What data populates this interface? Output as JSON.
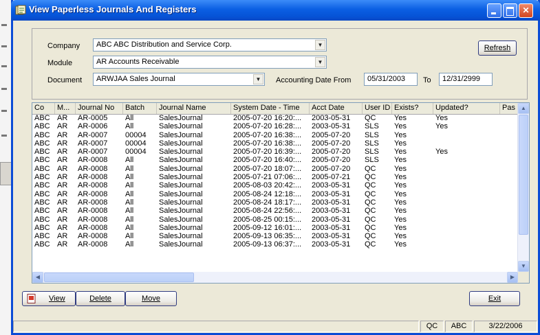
{
  "window": {
    "title": "View Paperless Journals And Registers"
  },
  "filters": {
    "company_label": "Company",
    "company_value": "ABC  ABC Distribution and Service Corp.",
    "module_label": "Module",
    "module_value": "AR  Accounts Receivable",
    "document_label": "Document",
    "document_value": "ARWJAA  Sales Journal",
    "date_from_label": "Accounting Date From",
    "date_from_value": "05/31/2003",
    "date_to_label": "To",
    "date_to_value": "12/31/2999"
  },
  "buttons": {
    "refresh": "Refresh",
    "view": "View",
    "delete": "Delete",
    "move": "Move",
    "exit": "Exit"
  },
  "grid": {
    "columns": [
      "Co",
      "M...",
      "Journal No",
      "Batch",
      "Journal Name",
      "System Date - Time",
      "Acct Date",
      "User ID",
      "Exists?",
      "Updated?",
      "Pas"
    ],
    "rows": [
      [
        "ABC",
        "AR",
        "AR-0005",
        "All",
        "SalesJournal",
        "2005-07-20 16:20:...",
        "2003-05-31",
        "QC",
        "Yes",
        "Yes",
        ""
      ],
      [
        "ABC",
        "AR",
        "AR-0006",
        "All",
        "SalesJournal",
        "2005-07-20 16:28:...",
        "2003-05-31",
        "SLS",
        "Yes",
        "Yes",
        ""
      ],
      [
        "ABC",
        "AR",
        "AR-0007",
        "00004",
        "SalesJournal",
        "2005-07-20 16:38:...",
        "2005-07-20",
        "SLS",
        "Yes",
        "",
        ""
      ],
      [
        "ABC",
        "AR",
        "AR-0007",
        "00004",
        "SalesJournal",
        "2005-07-20 16:38:...",
        "2005-07-20",
        "SLS",
        "Yes",
        "",
        ""
      ],
      [
        "ABC",
        "AR",
        "AR-0007",
        "00004",
        "SalesJournal",
        "2005-07-20 16:39:...",
        "2005-07-20",
        "SLS",
        "Yes",
        "Yes",
        ""
      ],
      [
        "ABC",
        "AR",
        "AR-0008",
        "All",
        "SalesJournal",
        "2005-07-20 16:40:...",
        "2005-07-20",
        "SLS",
        "Yes",
        "",
        ""
      ],
      [
        "ABC",
        "AR",
        "AR-0008",
        "All",
        "SalesJournal",
        "2005-07-20 18:07:...",
        "2005-07-20",
        "QC",
        "Yes",
        "",
        ""
      ],
      [
        "ABC",
        "AR",
        "AR-0008",
        "All",
        "SalesJournal",
        "2005-07-21 07:06:...",
        "2005-07-21",
        "QC",
        "Yes",
        "",
        ""
      ],
      [
        "ABC",
        "AR",
        "AR-0008",
        "All",
        "SalesJournal",
        "2005-08-03 20:42:...",
        "2003-05-31",
        "QC",
        "Yes",
        "",
        ""
      ],
      [
        "ABC",
        "AR",
        "AR-0008",
        "All",
        "SalesJournal",
        "2005-08-24 12:18:...",
        "2003-05-31",
        "QC",
        "Yes",
        "",
        ""
      ],
      [
        "ABC",
        "AR",
        "AR-0008",
        "All",
        "SalesJournal",
        "2005-08-24 18:17:...",
        "2003-05-31",
        "QC",
        "Yes",
        "",
        ""
      ],
      [
        "ABC",
        "AR",
        "AR-0008",
        "All",
        "SalesJournal",
        "2005-08-24 22:56:...",
        "2003-05-31",
        "QC",
        "Yes",
        "",
        ""
      ],
      [
        "ABC",
        "AR",
        "AR-0008",
        "All",
        "SalesJournal",
        "2005-08-25 00:15:...",
        "2003-05-31",
        "QC",
        "Yes",
        "",
        ""
      ],
      [
        "ABC",
        "AR",
        "AR-0008",
        "All",
        "SalesJournal",
        "2005-09-12 16:01:...",
        "2003-05-31",
        "QC",
        "Yes",
        "",
        ""
      ],
      [
        "ABC",
        "AR",
        "AR-0008",
        "All",
        "SalesJournal",
        "2005-09-13 06:35:...",
        "2003-05-31",
        "QC",
        "Yes",
        "",
        ""
      ],
      [
        "ABC",
        "AR",
        "AR-0008",
        "All",
        "SalesJournal",
        "2005-09-13 06:37:...",
        "2003-05-31",
        "QC",
        "Yes",
        "",
        ""
      ]
    ]
  },
  "status": {
    "user": "QC",
    "company": "ABC",
    "date": "3/22/2006"
  },
  "icons": {
    "app": "journal-icon",
    "view": "pdf-icon"
  },
  "colors": {
    "titlebar": "#0b5fe3",
    "window": "#ece9d8",
    "close": "#d2451f"
  }
}
